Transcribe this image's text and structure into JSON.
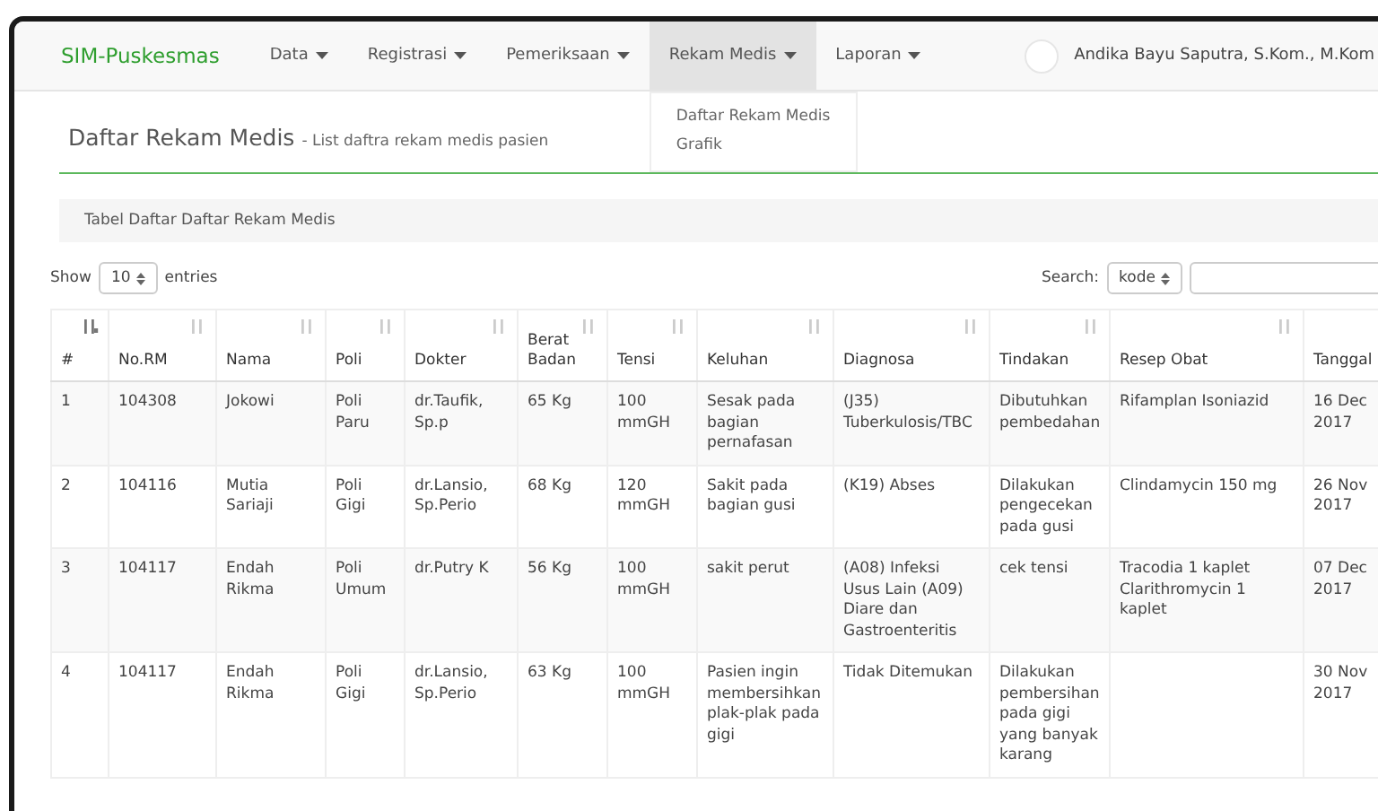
{
  "navbar": {
    "brand": "SIM-Puskesmas",
    "items": [
      {
        "label": "Data",
        "selected": false
      },
      {
        "label": "Registrasi",
        "selected": false
      },
      {
        "label": "Pemeriksaan",
        "selected": false
      },
      {
        "label": "Rekam Medis",
        "selected": true,
        "dropdown": [
          "Daftar Rekam Medis",
          "Grafik"
        ]
      },
      {
        "label": "Laporan",
        "selected": false
      }
    ],
    "user": "Andika Bayu Saputra, S.Kom., M.Kom"
  },
  "page": {
    "title": "Daftar Rekam Medis",
    "subtitle": "- List daftra rekam medis pasien"
  },
  "panel": {
    "heading": "Tabel Daftar Daftar Rekam Medis"
  },
  "controls": {
    "show_label": "Show",
    "length_value": "10",
    "entries_label": "entries",
    "search_label": "Search:",
    "search_column": "kode"
  },
  "table": {
    "columns": [
      {
        "label": "#",
        "sorted": true
      },
      {
        "label": "No.RM",
        "sorted": false
      },
      {
        "label": "Nama",
        "sorted": false
      },
      {
        "label": "Poli",
        "sorted": false
      },
      {
        "label": "Dokter",
        "sorted": false
      },
      {
        "label": "Berat Badan",
        "sorted": false
      },
      {
        "label": "Tensi",
        "sorted": false
      },
      {
        "label": "Keluhan",
        "sorted": false
      },
      {
        "label": "Diagnosa",
        "sorted": false
      },
      {
        "label": "Tindakan",
        "sorted": false
      },
      {
        "label": "Resep Obat",
        "sorted": false
      },
      {
        "label": "Tanggal"
      }
    ],
    "rows": [
      [
        "1",
        "104308",
        "Jokowi",
        "Poli Paru",
        "dr.Taufik, Sp.p",
        "65 Kg",
        "100 mmGH",
        "Sesak pada bagian pernafasan",
        "(J35) Tuberkulosis/TBC",
        "Dibutuhkan pembedahan",
        "Rifamplan Isoniazid",
        "16 Dec 2017"
      ],
      [
        "2",
        "104116",
        "Mutia Sariaji",
        "Poli Gigi",
        "dr.Lansio, Sp.Perio",
        "68 Kg",
        "120 mmGH",
        "Sakit pada bagian gusi",
        "(K19) Abses",
        "Dilakukan pengecekan pada gusi",
        "Clindamycin 150 mg",
        "26 Nov 2017"
      ],
      [
        "3",
        "104117",
        "Endah Rikma",
        "Poli Umum",
        "dr.Putry K",
        "56 Kg",
        "100 mmGH",
        "sakit perut",
        "(A08) Infeksi Usus Lain (A09) Diare dan Gastroenteritis",
        "cek tensi",
        "Tracodia 1 kaplet Clarithromycin 1 kaplet",
        "07 Dec 2017"
      ],
      [
        "4",
        "104117",
        "Endah Rikma",
        "Poli Gigi",
        "dr.Lansio, Sp.Perio",
        "63 Kg",
        "100 mmGH",
        "Pasien ingin membersihkan plak-plak pada gigi",
        "Tidak Ditemukan",
        "Dilakukan pembersihan pada gigi yang banyak karang",
        "",
        "30 Nov 2017"
      ]
    ]
  }
}
